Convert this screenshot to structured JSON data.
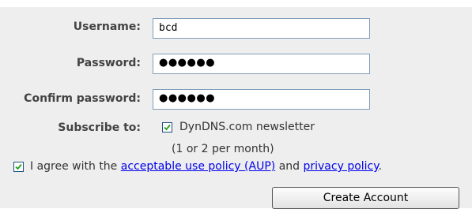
{
  "form": {
    "username_label": "Username:",
    "username_value": "bcd",
    "password_label": "Password:",
    "password_mask": "●●●●●●",
    "confirm_label": "Confirm password:",
    "confirm_mask": "●●●●●●",
    "subscribe_label": "Subscribe to:",
    "newsletter_label": "DynDNS.com newsletter",
    "newsletter_checked": true,
    "newsletter_note": "(1 or 2 per month)",
    "agree_checked": true,
    "agree_prefix": "I agree with the",
    "aup_link": "acceptable use policy (AUP)",
    "agree_and": "and",
    "privacy_link": "privacy policy",
    "agree_suffix": ".",
    "create_button": "Create Account"
  }
}
